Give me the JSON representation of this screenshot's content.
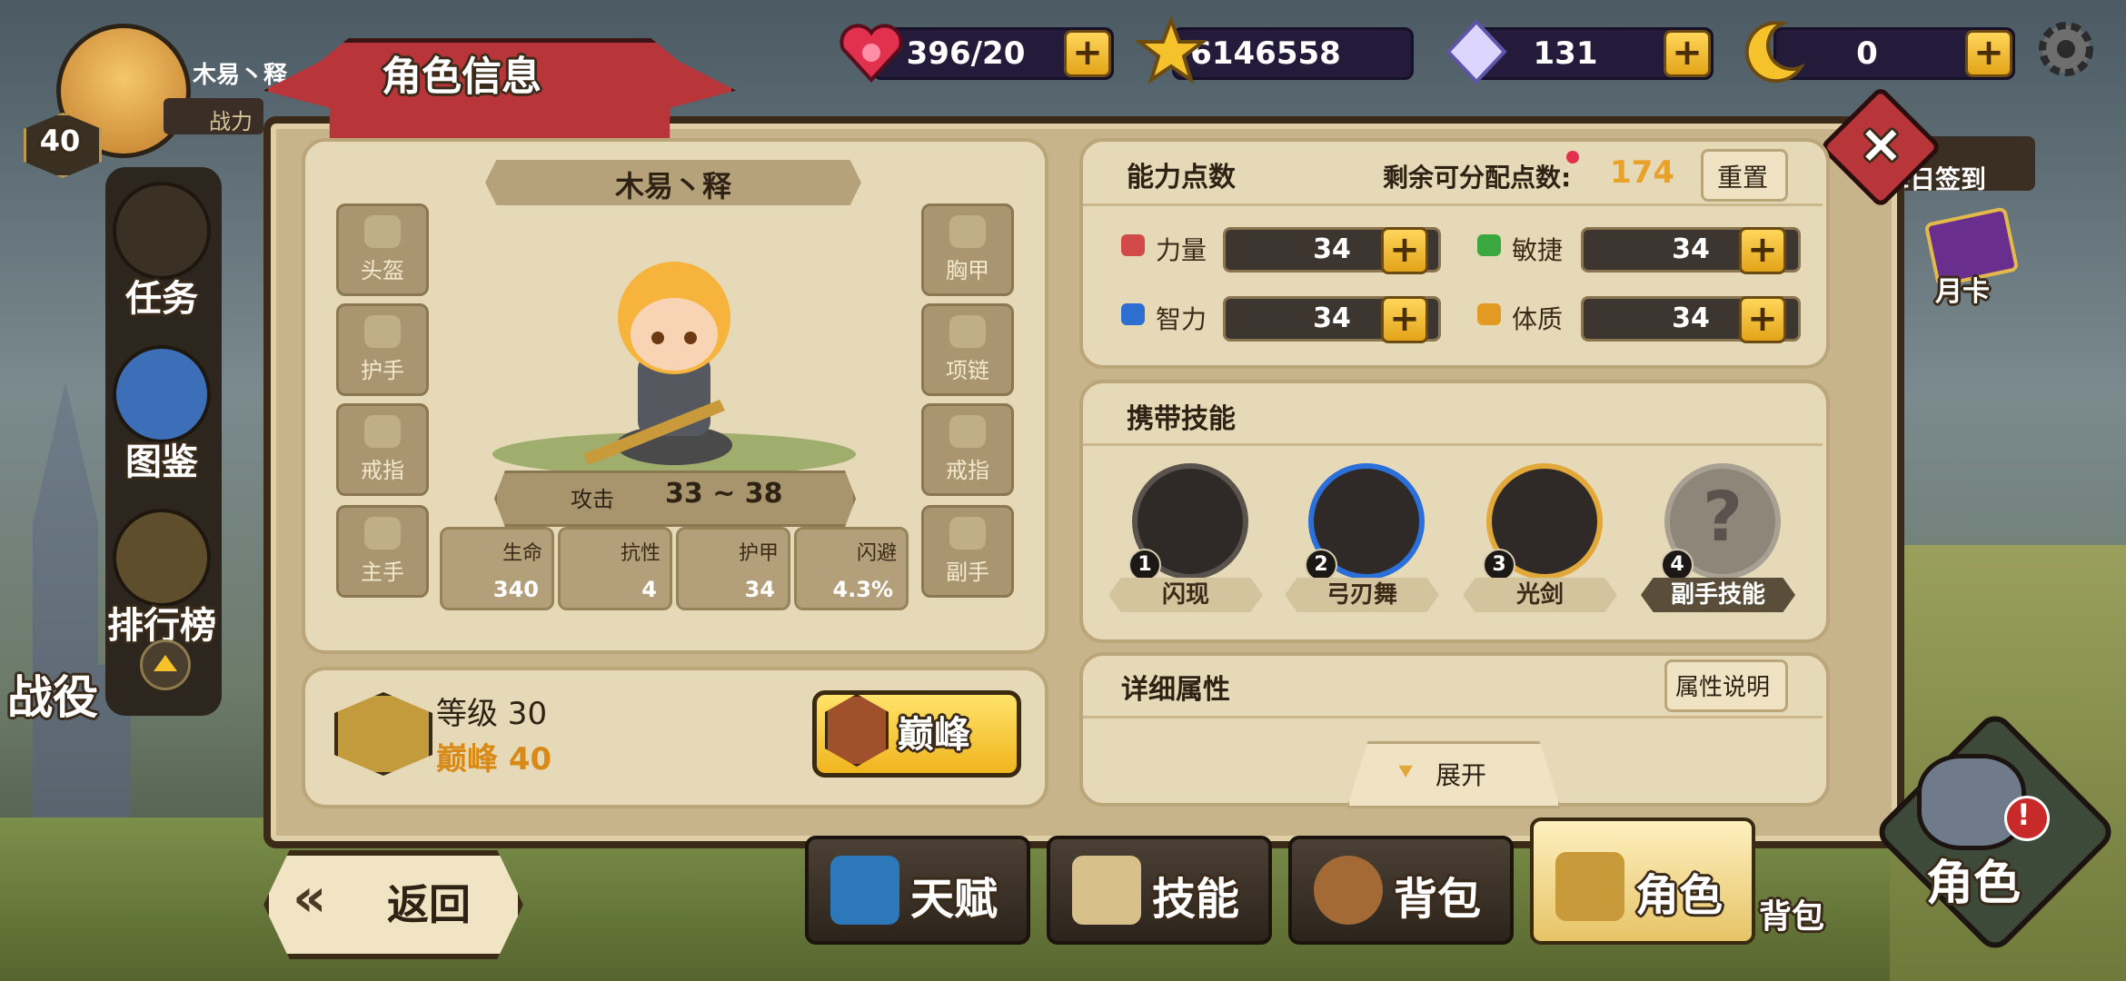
{
  "player": {
    "name": "木易丶释",
    "level_badge": "40",
    "power_label": "战力"
  },
  "currency": [
    {
      "id": "stamina",
      "value": "396/20"
    },
    {
      "id": "gold",
      "value": "6146558"
    },
    {
      "id": "diamond",
      "value": "131"
    },
    {
      "id": "moon",
      "value": "0"
    }
  ],
  "plus_symbol": "+",
  "side_menu": [
    "任务",
    "图鉴",
    "排行榜"
  ],
  "campaign_label": "战役",
  "right_menu": {
    "daily_signin": "每日签到",
    "monthly_card": "月卡"
  },
  "panel": {
    "title": "角色信息",
    "character_name": "木易丶释",
    "slots_left": [
      "头盔",
      "护手",
      "戒指",
      "主手"
    ],
    "slots_right": [
      "胸甲",
      "项链",
      "戒指",
      "副手"
    ],
    "attack": {
      "label": "攻击",
      "value": "33 ~ 38"
    },
    "stats": [
      {
        "label": "生命",
        "value": "340"
      },
      {
        "label": "抗性",
        "value": "4"
      },
      {
        "label": "护甲",
        "value": "34"
      },
      {
        "label": "闪避",
        "value": "4.3%"
      }
    ],
    "level_text": "等级 30",
    "peak_text": "巅峰 40",
    "peak_button": "巅峰"
  },
  "ability": {
    "title": "能力点数",
    "remaining_label": "剩余可分配点数:",
    "remaining_value": "174",
    "reset": "重置",
    "attrs": [
      {
        "label": "力量",
        "value": "34"
      },
      {
        "label": "敏捷",
        "value": "34"
      },
      {
        "label": "智力",
        "value": "34"
      },
      {
        "label": "体质",
        "value": "34"
      }
    ]
  },
  "skills": {
    "title": "携带技能",
    "items": [
      {
        "num": "1",
        "name": "闪现"
      },
      {
        "num": "2",
        "name": "弓刃舞"
      },
      {
        "num": "3",
        "name": "光剑"
      },
      {
        "num": "4",
        "name": "副手技能",
        "icon": "?"
      }
    ]
  },
  "details": {
    "title": "详细属性",
    "help": "属性说明",
    "expand": "展开"
  },
  "back_label": "返回",
  "tabs": [
    "天赋",
    "技能",
    "背包",
    "角色"
  ],
  "bg_labels": {
    "bag": "背包",
    "role": "角色",
    "alert": "!"
  },
  "colors": {
    "accent_gold": "#f5c542",
    "orange_text": "#d98a16",
    "ribbon_red": "#b8353a"
  }
}
